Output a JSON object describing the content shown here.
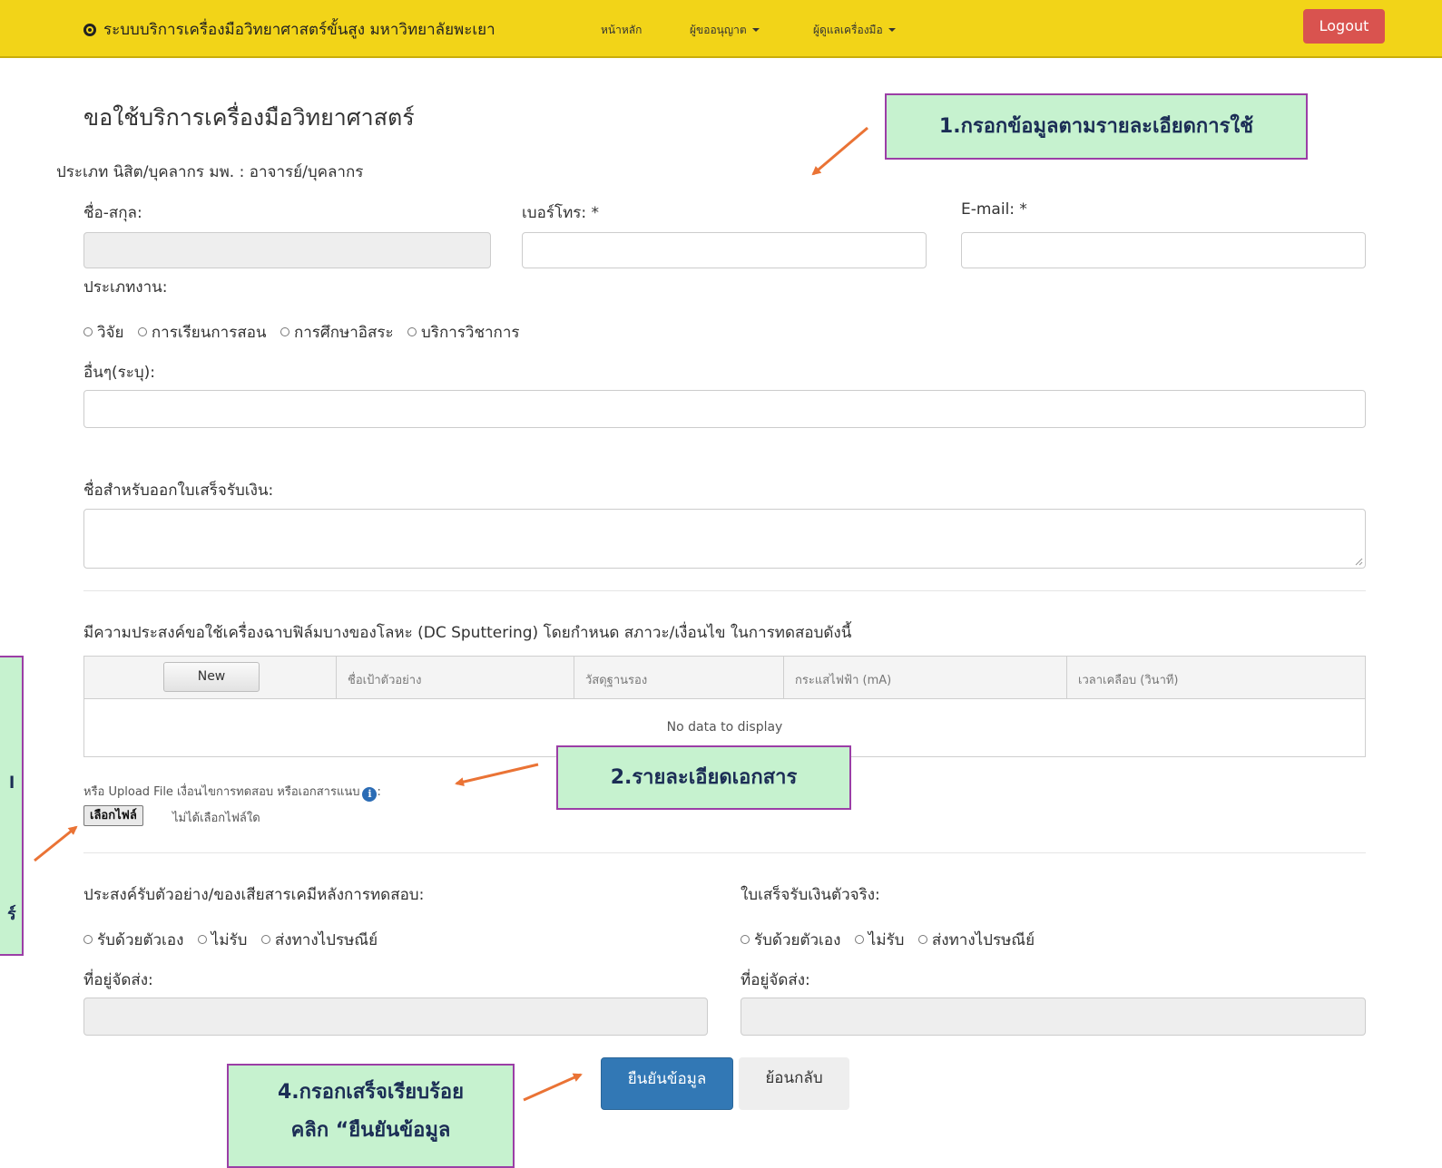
{
  "navbar": {
    "brand": "ระบบบริการเครื่องมือวิทยาศาสตร์ขั้นสูง มหาวิทยาลัยพะเยา",
    "links": [
      {
        "label": "หน้าหลัก"
      },
      {
        "label": "ผู้ขออนุญาต"
      },
      {
        "label": "ผู้ดูแลเครื่องมือ"
      }
    ],
    "logout": "Logout"
  },
  "page": {
    "title": "ขอใช้บริการเครื่องมือวิทยาศาสตร์",
    "user_type": "ประเภท นิสิต/บุคลากร มพ. : อาจารย์/บุคลากร"
  },
  "form": {
    "name_label": "ชื่อ-สกุล:",
    "phone_label": "เบอร์โทร: *",
    "email_label": "E-mail: *",
    "work_type_label": "ประเภทงาน:",
    "work_types": [
      "วิจัย",
      "การเรียนการสอน",
      "การศึกษาอิสระ",
      "บริการวิชาการ"
    ],
    "other_label": "อื่นๆ(ระบุ):",
    "receipt_name_label": "ชื่อสำหรับออกใบเสร็จรับเงิน:",
    "purpose_text": "มีความประสงค์ขอใช้เครื่องฉาบฟิล์มบางของโลหะ (DC Sputtering) โดยกำหนด สภาวะ/เงื่อนไข ในการทดสอบดังนี้",
    "grid": {
      "new_button": "New",
      "columns": [
        "ชื่อเป้าตัวอย่าง",
        "วัสดุฐานรอง",
        "กระแสไฟฟ้า (mA)",
        "เวลาเคลือบ (วินาที)"
      ],
      "empty_text": "No data to display"
    },
    "upload_label": "หรือ Upload File เงื่อนไขการทดสอบ หรือเอกสารแนบ",
    "upload_colon": ":",
    "file_button": "เลือกไฟล์",
    "file_status": "ไม่ได้เลือกไฟล์ใด",
    "sample_return_label": "ประสงค์รับตัวอย่าง/ของเสียสารเคมีหลังการทดสอบ:",
    "sample_return_options": [
      "รับด้วยตัวเอง",
      "ไม่รับ",
      "ส่งทางไปรษณีย์"
    ],
    "receipt_label": "ใบเสร็จรับเงินตัวจริง:",
    "receipt_options": [
      "รับด้วยตัวเอง",
      "ไม่รับ",
      "ส่งทางไปรษณีย์"
    ],
    "address_label": "ที่อยู่จัดส่ง:",
    "submit": "ยืนยันข้อมูล",
    "back": "ย้อนกลับ"
  },
  "annotations": {
    "callout1": "1.กรอกข้อมูลตามรายละเอียดการใช้",
    "callout2": "2.รายละเอียดเอกสาร",
    "callout4_line1": "4.กรอกเสร็จเรียบร้อย",
    "callout4_line2": "คลิก “ยืนยันข้อมูล",
    "callout3_fragment_1": "l",
    "callout3_fragment_2": "ร์"
  },
  "colors": {
    "navbar": "#f2d418",
    "logout": "#d9534f",
    "primary": "#3278b5",
    "callout_bg": "#c6f2cf",
    "callout_border": "#9b3ea6",
    "arrow": "#ea7335"
  }
}
